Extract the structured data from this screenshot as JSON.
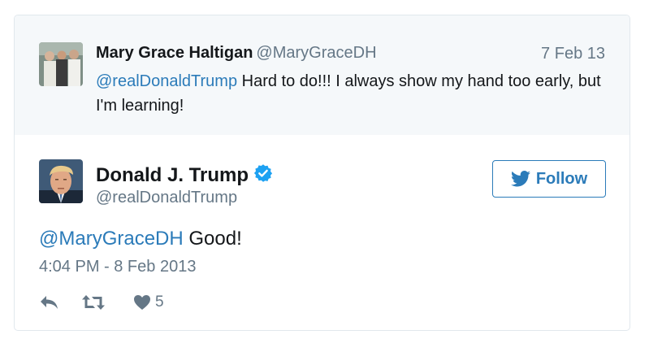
{
  "reply_tweet": {
    "name": "Mary Grace Haltigan",
    "handle": "@MaryGraceDH",
    "date": "7 Feb 13",
    "mention": "@realDonaldTrump",
    "text": " Hard to do!!! I always show my hand too early, but I'm learning!"
  },
  "main_tweet": {
    "name": "Donald J. Trump",
    "handle": "@realDonaldTrump",
    "follow_label": "Follow",
    "mention": "@MaryGraceDH",
    "text": " Good!",
    "timestamp": "4:04 PM - 8 Feb 2013",
    "like_count": "5"
  },
  "colors": {
    "link": "#2b7bb9",
    "muted": "#657786",
    "verified": "#1da1f2",
    "reply_bg": "#f5f8fa"
  },
  "icons": [
    "reply-icon",
    "retweet-icon",
    "heart-icon",
    "twitter-bird-icon",
    "verified-badge-icon"
  ]
}
